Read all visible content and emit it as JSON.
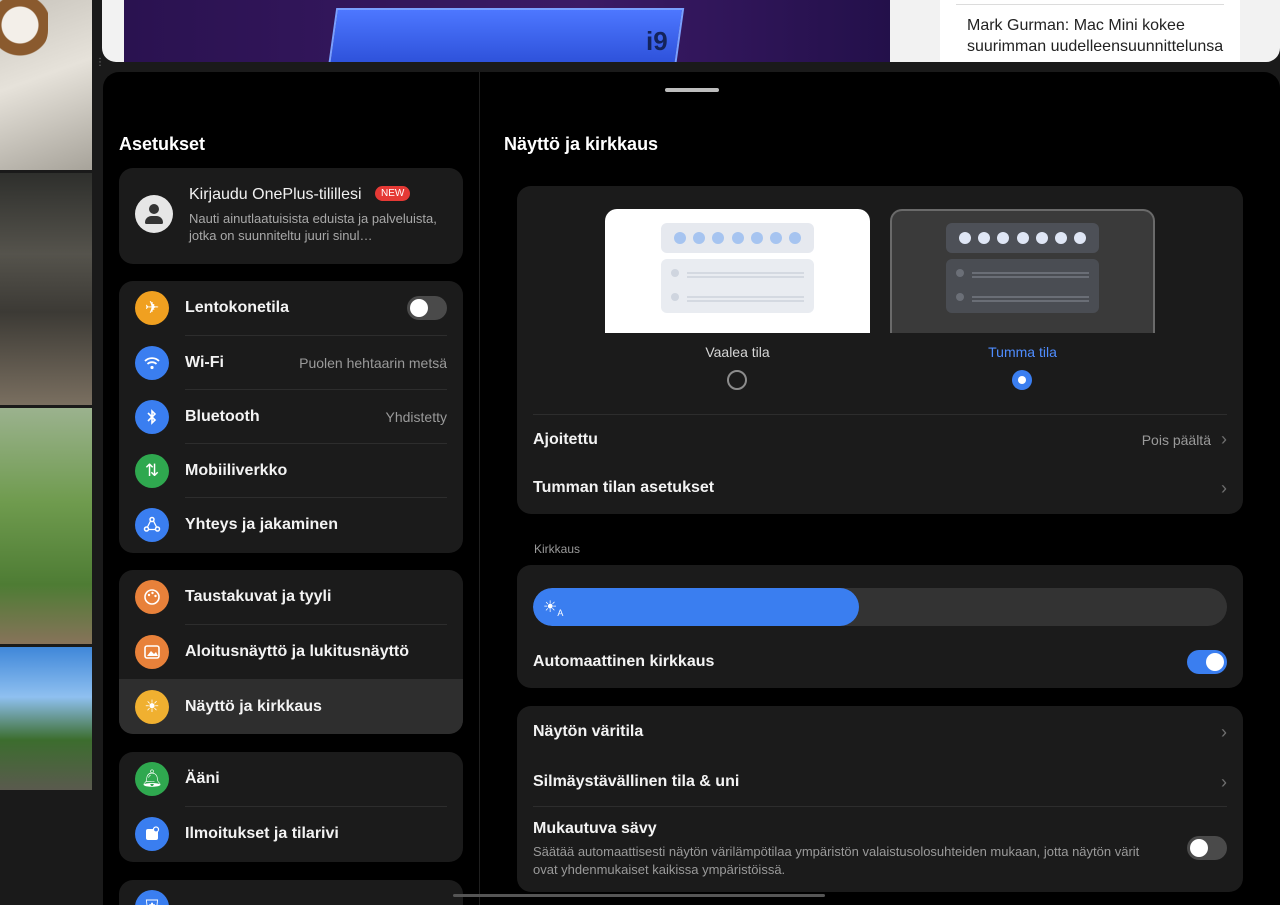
{
  "news": {
    "hero_text": "i9",
    "headline": "Mark Gurman: Mac Mini kokee suurimman uudelleensuunnittelunsa"
  },
  "left": {
    "title": "Asetukset",
    "account": {
      "title": "Kirjaudu OnePlus-tilillesi",
      "badge": "NEW",
      "subtitle": "Nauti ainutlaatuisista eduista ja palveluista, jotka on suunniteltu juuri sinul…"
    },
    "group1": [
      {
        "label": "Lentokonetila",
        "icon": "airplane-icon",
        "value": "",
        "toggle": false,
        "color": "#f0a020"
      },
      {
        "label": "Wi-Fi",
        "icon": "wifi-icon",
        "value": "Puolen hehtaarin metsä",
        "color": "#3a7ef0"
      },
      {
        "label": "Bluetooth",
        "icon": "bluetooth-icon",
        "value": "Yhdistetty",
        "color": "#3a7ef0"
      },
      {
        "label": "Mobiiliverkko",
        "icon": "mobile-data-icon",
        "value": "",
        "color": "#2fa84f"
      },
      {
        "label": "Yhteys ja jakaminen",
        "icon": "share-icon",
        "value": "",
        "color": "#3a7ef0"
      }
    ],
    "group2": [
      {
        "label": "Taustakuvat ja tyyli",
        "icon": "palette-icon",
        "color": "#e8813a"
      },
      {
        "label": "Aloitusnäyttö ja lukitusnäyttö",
        "icon": "image-icon",
        "color": "#e8813a"
      },
      {
        "label": "Näyttö ja kirkkaus",
        "icon": "sun-icon",
        "color": "#f0b030",
        "selected": true
      }
    ],
    "group3": [
      {
        "label": "Ääni",
        "icon": "bell-icon",
        "color": "#2fa84f"
      },
      {
        "label": "Ilmoitukset ja tilarivi",
        "icon": "notification-icon",
        "color": "#3a7ef0"
      }
    ]
  },
  "right": {
    "title": "Näyttö ja kirkkaus",
    "theme": {
      "light_label": "Vaalea tila",
      "dark_label": "Tumma tila",
      "selected": "dark"
    },
    "scheduled": {
      "label": "Ajoitettu",
      "value": "Pois päältä"
    },
    "dark_settings": {
      "label": "Tumman tilan asetukset"
    },
    "brightness_section": "Kirkkaus",
    "brightness_level": 0.47,
    "auto_brightness": {
      "label": "Automaattinen kirkkaus",
      "on": true
    },
    "color_mode": {
      "label": "Näytön väritila"
    },
    "eye_comfort": {
      "label": "Silmäystävällinen tila & uni"
    },
    "adaptive": {
      "label": "Mukautuva sävy",
      "description": "Säätää automaattisesti näytön värilämpötilaa ympäristön valaistusolosuhteiden mukaan, jotta näytön värit ovat yhdenmukaiset kaikissa ympäristöissä.",
      "on": false
    }
  }
}
